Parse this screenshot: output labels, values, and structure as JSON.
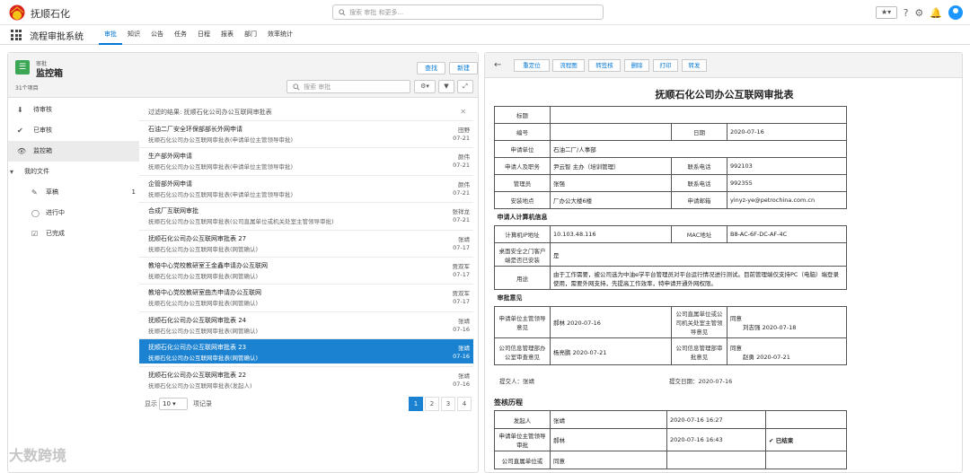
{
  "header": {
    "brand": "抚顺石化",
    "search_placeholder": "搜索 审批 和更多...",
    "fav_label": "★▾"
  },
  "nav": {
    "app_name": "流程审批系统",
    "tabs": [
      "审批",
      "知识",
      "公告",
      "任务",
      "日程",
      "报表",
      "部门",
      "效率统计"
    ],
    "active_tab": "审批"
  },
  "list_view": {
    "supertitle": "审批",
    "title": "监控箱",
    "count": "31个项目",
    "find_label": "查找",
    "new_label": "新建",
    "search_placeholder": "搜索 审批",
    "filter_text": "过滤的结果: 抚顺石化公司办公互联网审批表",
    "folders": [
      {
        "icon": "⬇",
        "label": "待审核",
        "count": ""
      },
      {
        "icon": "✔",
        "label": "已审核",
        "count": ""
      },
      {
        "icon": "👁",
        "label": "监控箱",
        "count": ""
      },
      {
        "icon": "▾",
        "label": "我的文件",
        "count": ""
      },
      {
        "icon": "✎",
        "label": "草稿",
        "count": "1"
      },
      {
        "icon": "◯",
        "label": "进行中",
        "count": ""
      },
      {
        "icon": "☑",
        "label": "已完成",
        "count": ""
      }
    ],
    "rows": [
      {
        "title": "石油二厂安全环保部部长外网申请",
        "subtitle": "抚顺石化公司办公互联网审批表(申请单位主管领导审批)",
        "person": "田野",
        "date": "07-21"
      },
      {
        "title": "生产部外网申请",
        "subtitle": "抚顺石化公司办公互联网审批表(申请单位主管领导审批)",
        "person": "颜伟",
        "date": "07-21"
      },
      {
        "title": "企管部外网申请",
        "subtitle": "抚顺石化公司办公互联网审批表(申请单位主管领导审批)",
        "person": "颜伟",
        "date": "07-21"
      },
      {
        "title": "合成厂互联网审批",
        "subtitle": "抚顺石化公司办公互联网审批表(公司直属单位或机关处室主管领导审批)",
        "person": "张祥龙",
        "date": "07-21"
      },
      {
        "title": "抚顺石化公司办公互联网审批表 27",
        "subtitle": "抚顺石化公司办公互联网审批表(网管确认)",
        "person": "张靖",
        "date": "07-17"
      },
      {
        "title": "教培中心党校教研室王金鑫申请办公互联网",
        "subtitle": "抚顺石化公司办公互联网审批表(网管确认)",
        "person": "贾双军",
        "date": "07-17"
      },
      {
        "title": "教培中心党校教研室曲杰申请办公互联网",
        "subtitle": "抚顺石化公司办公互联网审批表(网管确认)",
        "person": "贾双军",
        "date": "07-17"
      },
      {
        "title": "抚顺石化公司办公互联网审批表 24",
        "subtitle": "抚顺石化公司办公互联网审批表(网管确认)",
        "person": "张靖",
        "date": "07-16"
      },
      {
        "title": "抚顺石化公司办公互联网审批表 23",
        "subtitle": "抚顺石化公司办公互联网审批表(网管确认)",
        "person": "张靖",
        "date": "07-16"
      },
      {
        "title": "抚顺石化公司办公互联网审批表 22",
        "subtitle": "抚顺石化公司办公互联网审批表(发起人)",
        "person": "张靖",
        "date": "07-16"
      }
    ],
    "selected_index": 8,
    "pager": {
      "show_label": "显示",
      "page_size": "10",
      "records_label": "项记录",
      "pages": [
        "1",
        "2",
        "3",
        "4"
      ],
      "current": "1"
    }
  },
  "detail": {
    "toolbar": [
      "重定位",
      "流程图",
      "转签核",
      "删除",
      "打印",
      "转发"
    ],
    "doc_title": "抚顺石化公司办公互联网审批表",
    "labels": {
      "subject": "标题",
      "number": "编号",
      "date": "日期",
      "unit": "申请单位",
      "applicant": "申请人及职务",
      "phone": "联系电话",
      "admin": "管理员",
      "admin_phone": "联系电话",
      "location": "安装地点",
      "email": "申请邮箱",
      "section_pc": "申请人计算机信息",
      "ip": "计算机IP地址",
      "mac": "MAC地址",
      "safety": "桌面安全之门客户端是否已安装",
      "purpose": "用途",
      "section_opinion": "审批意见",
      "op1": "申请单位主管领导意见",
      "op2": "公司直属单位或公司机关处室主管领导意见",
      "op3": "公司信息管理部办公室审查意见",
      "op4": "公司信息管理部审批意见"
    },
    "values": {
      "subject": "",
      "number": "",
      "date": "2020-07-16",
      "unit": "石油二厂/人事部",
      "applicant": "尹云智 主办（培训管理）",
      "phone": "992103",
      "admin": "张强",
      "admin_phone": "992355",
      "location": "厂办公大楼6楼",
      "email": "yinyz-ye@petrochina.com.cn",
      "ip": "10.103.48.116",
      "mac": "B8-AC-6F-DC-AF-4C",
      "safety": "是",
      "purpose": "由于工作需要，被公司选为中油e学平台管理员对平台运行情况进行测试。目前管理端仅支持PC（电脑）端登录使用，需要外网支持，先提高工作效率，特申请开通外网权限。",
      "op1": "郝林 2020-07-16",
      "op2_a": "同意",
      "op2_b": "刘志强 2020-07-18",
      "op3": "杨亮鹏 2020-07-21",
      "op4_a": "同意",
      "op4_b": "赵勇 2020-07-21"
    },
    "submitter": "提交人：张靖",
    "submit_date": "提交日期：2020-07-16",
    "history_title": "签核历程",
    "history": [
      {
        "role": "发起人",
        "name": "张靖",
        "time": "2020-07-16 16:27",
        "status": ""
      },
      {
        "role": "申请单位主管领导审批",
        "name": "郝林",
        "time": "2020-07-16 16:43",
        "status": "✔ 已结束"
      },
      {
        "role": "公司直属单位或",
        "name": "同意",
        "time": "",
        "status": ""
      }
    ]
  },
  "watermark": "大数跨境"
}
